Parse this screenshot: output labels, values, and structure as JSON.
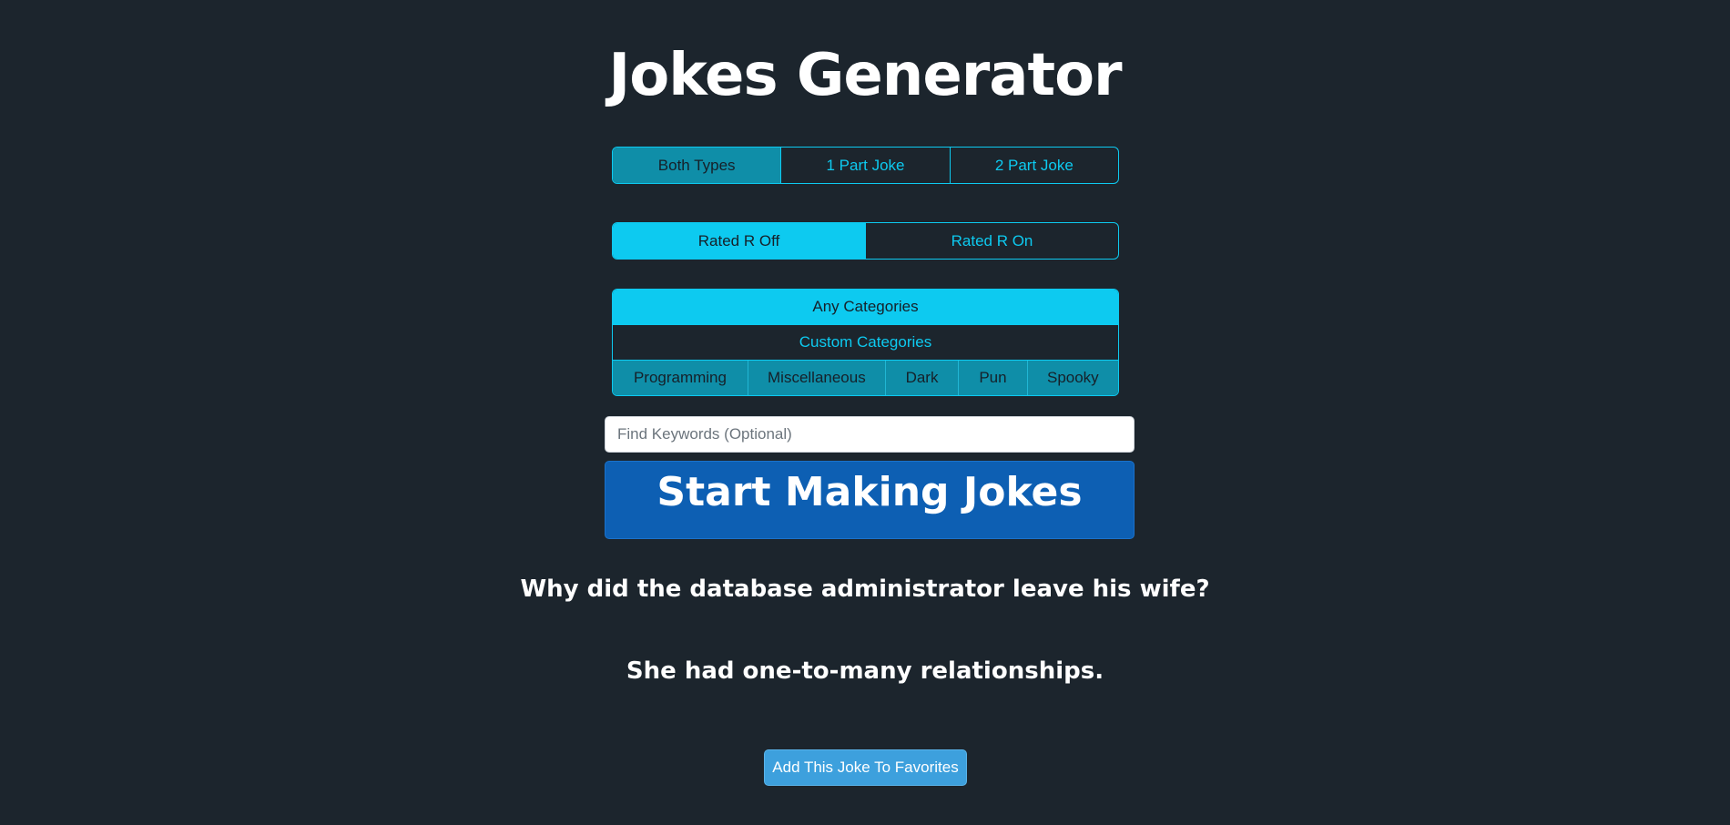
{
  "title": "Jokes Generator",
  "joke_type": {
    "options": [
      "Both Types",
      "1 Part Joke",
      "2 Part Joke"
    ],
    "selected": "Both Types"
  },
  "rating": {
    "options": [
      "Rated R Off",
      "Rated R On"
    ],
    "selected": "Rated R Off"
  },
  "categories": {
    "any_label": "Any Categories",
    "custom_label": "Custom Categories",
    "items": [
      "Programming",
      "Miscellaneous",
      "Dark",
      "Pun",
      "Spooky"
    ]
  },
  "search": {
    "placeholder": "Find Keywords (Optional)",
    "value": ""
  },
  "start_button_label": "Start Making Jokes",
  "joke": {
    "setup": "Why did the database administrator leave his wife?",
    "delivery": "She had one-to-many relationships."
  },
  "favorite_button_label": "Add This Joke To Favorites",
  "colors": {
    "background": "#1c252d",
    "accent": "#0dcaf0",
    "accent_dim": "#0f8ea8",
    "primary_button": "#0d5fb3",
    "favorite_button": "#3da0dd"
  }
}
